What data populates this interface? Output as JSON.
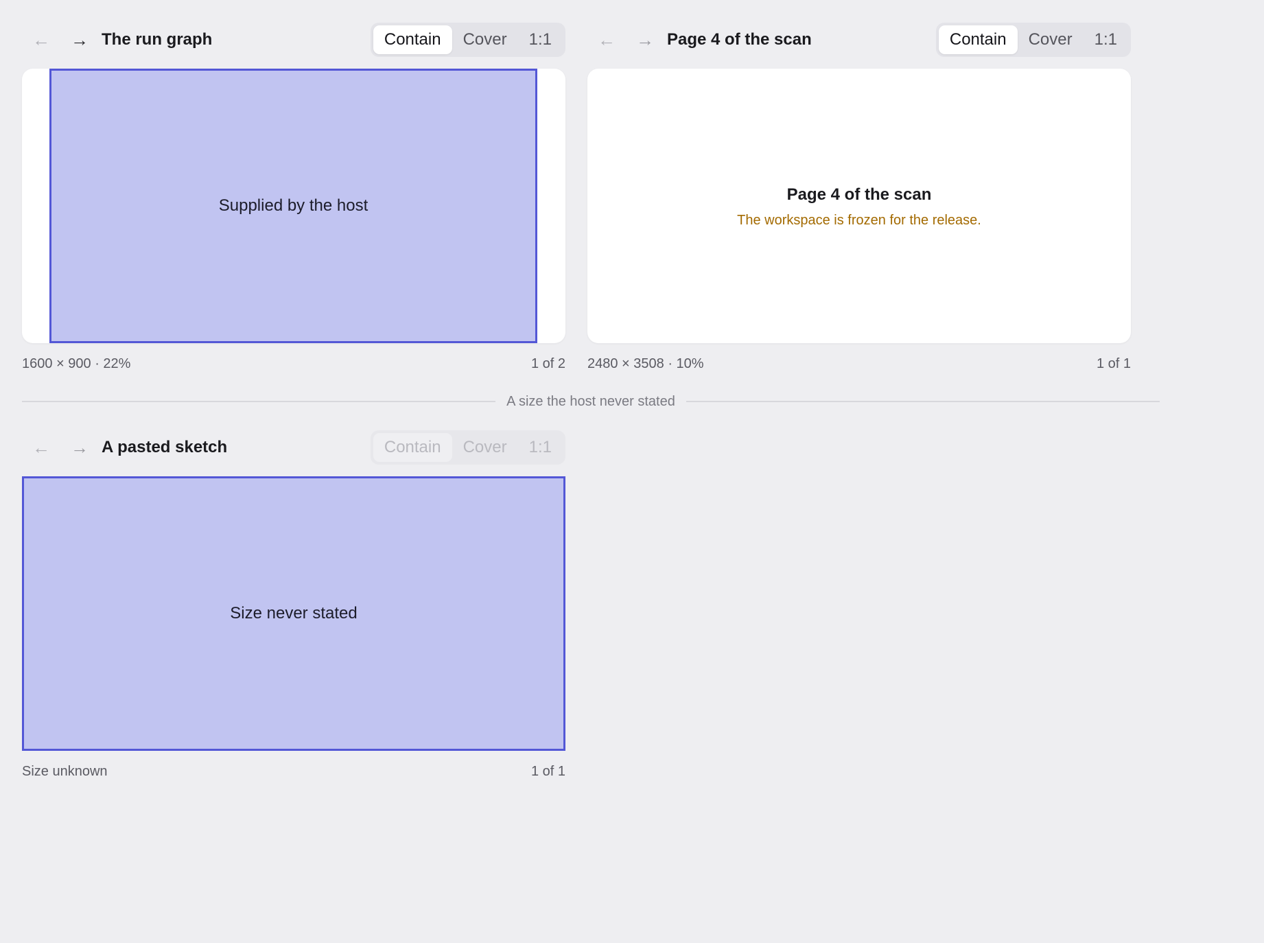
{
  "viewers": [
    {
      "title": "The run graph",
      "nav": {
        "back_icon": "←",
        "forward_icon": "→"
      },
      "fit_modes": {
        "contain": "Contain",
        "cover": "Cover",
        "actual": "1:1",
        "selected": "contain"
      },
      "image_label": "Supplied by the host",
      "footer": {
        "info": "1600 × 900 · 22%",
        "position": "1 of 2"
      }
    },
    {
      "title": "Page 4 of the scan",
      "nav": {
        "back_icon": "←",
        "forward_icon": "→"
      },
      "fit_modes": {
        "contain": "Contain",
        "cover": "Cover",
        "actual": "1:1",
        "selected": "contain"
      },
      "message": {
        "title": "Page 4 of the scan",
        "note": "The workspace is frozen for the release."
      },
      "footer": {
        "info": "2480 × 3508 · 10%",
        "position": "1 of 1"
      }
    },
    {
      "title": "A pasted sketch",
      "nav": {
        "back_icon": "←",
        "forward_icon": "→"
      },
      "fit_modes": {
        "contain": "Contain",
        "cover": "Cover",
        "actual": "1:1",
        "selected": "contain",
        "disabled": true
      },
      "image_label": "Size never stated",
      "footer": {
        "info": "Size unknown",
        "position": "1 of 1"
      }
    }
  ],
  "divider": {
    "label": "A size the host never stated"
  },
  "colors": {
    "background": "#eeeef1",
    "image_fill": "#c1c4f1",
    "image_border": "#5357d6",
    "warning_text": "#a36a00"
  }
}
